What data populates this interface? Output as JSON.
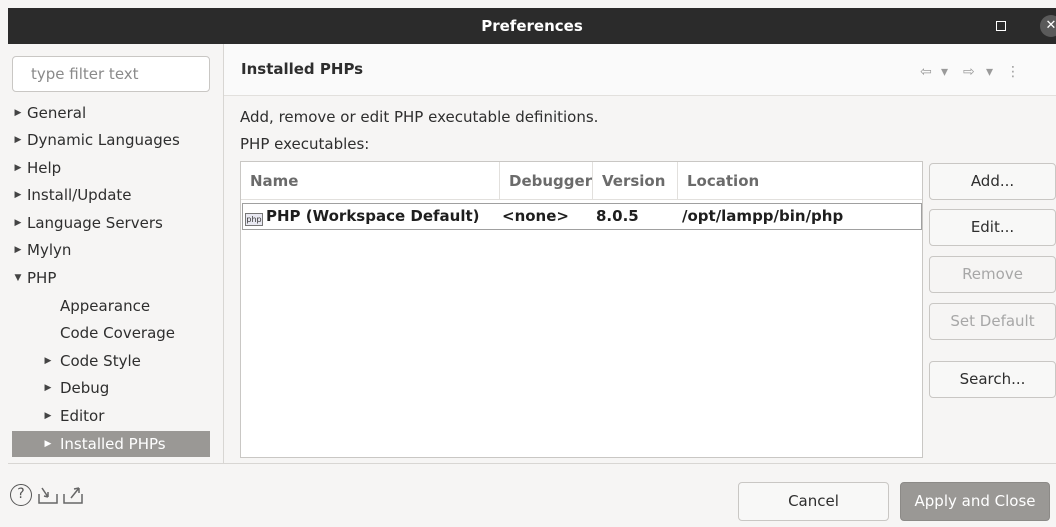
{
  "window": {
    "title": "Preferences",
    "maximize_icon": "maximize-icon",
    "close_icon": "close-icon"
  },
  "filter": {
    "placeholder": "type filter text",
    "value": ""
  },
  "tree": [
    {
      "label": "General",
      "arrow": "▶",
      "level": 0
    },
    {
      "label": "Dynamic Languages",
      "arrow": "▶",
      "level": 0
    },
    {
      "label": "Help",
      "arrow": "▶",
      "level": 0
    },
    {
      "label": "Install/Update",
      "arrow": "▶",
      "level": 0
    },
    {
      "label": "Language Servers",
      "arrow": "▶",
      "level": 0
    },
    {
      "label": "Mylyn",
      "arrow": "▶",
      "level": 0
    },
    {
      "label": "PHP",
      "arrow": "▼",
      "level": 0,
      "expanded": true
    },
    {
      "label": "Appearance",
      "arrow": "",
      "level": 1
    },
    {
      "label": "Code Coverage",
      "arrow": "",
      "level": 1
    },
    {
      "label": "Code Style",
      "arrow": "▶",
      "level": 1
    },
    {
      "label": "Debug",
      "arrow": "▶",
      "level": 1
    },
    {
      "label": "Editor",
      "arrow": "▶",
      "level": 1
    },
    {
      "label": "Installed PHPs",
      "arrow": "▶",
      "level": 1,
      "selected": true
    }
  ],
  "page": {
    "title": "Installed PHPs",
    "description": "Add, remove or edit PHP executable definitions.",
    "executables_label": "PHP executables:",
    "nav": {
      "back": "⇦",
      "back_menu": "▾",
      "forward": "⇨",
      "forward_menu": "▾",
      "more": "⋮"
    }
  },
  "table": {
    "columns": [
      "Name",
      "Debugger",
      "Version",
      "Location"
    ],
    "rows": [
      {
        "icon": "php",
        "name": "PHP (Workspace Default)",
        "debugger": "<none>",
        "version": "8.0.5",
        "location": "/opt/lampp/bin/php"
      }
    ]
  },
  "buttons": {
    "add": "Add...",
    "edit": "Edit...",
    "remove": "Remove",
    "set_default": "Set Default",
    "search": "Search...",
    "cancel": "Cancel",
    "apply_close": "Apply and Close"
  },
  "colors": {
    "titlebar": "#2b2b2b",
    "selection": "#9a9895",
    "primary_button": "#9a9895"
  }
}
